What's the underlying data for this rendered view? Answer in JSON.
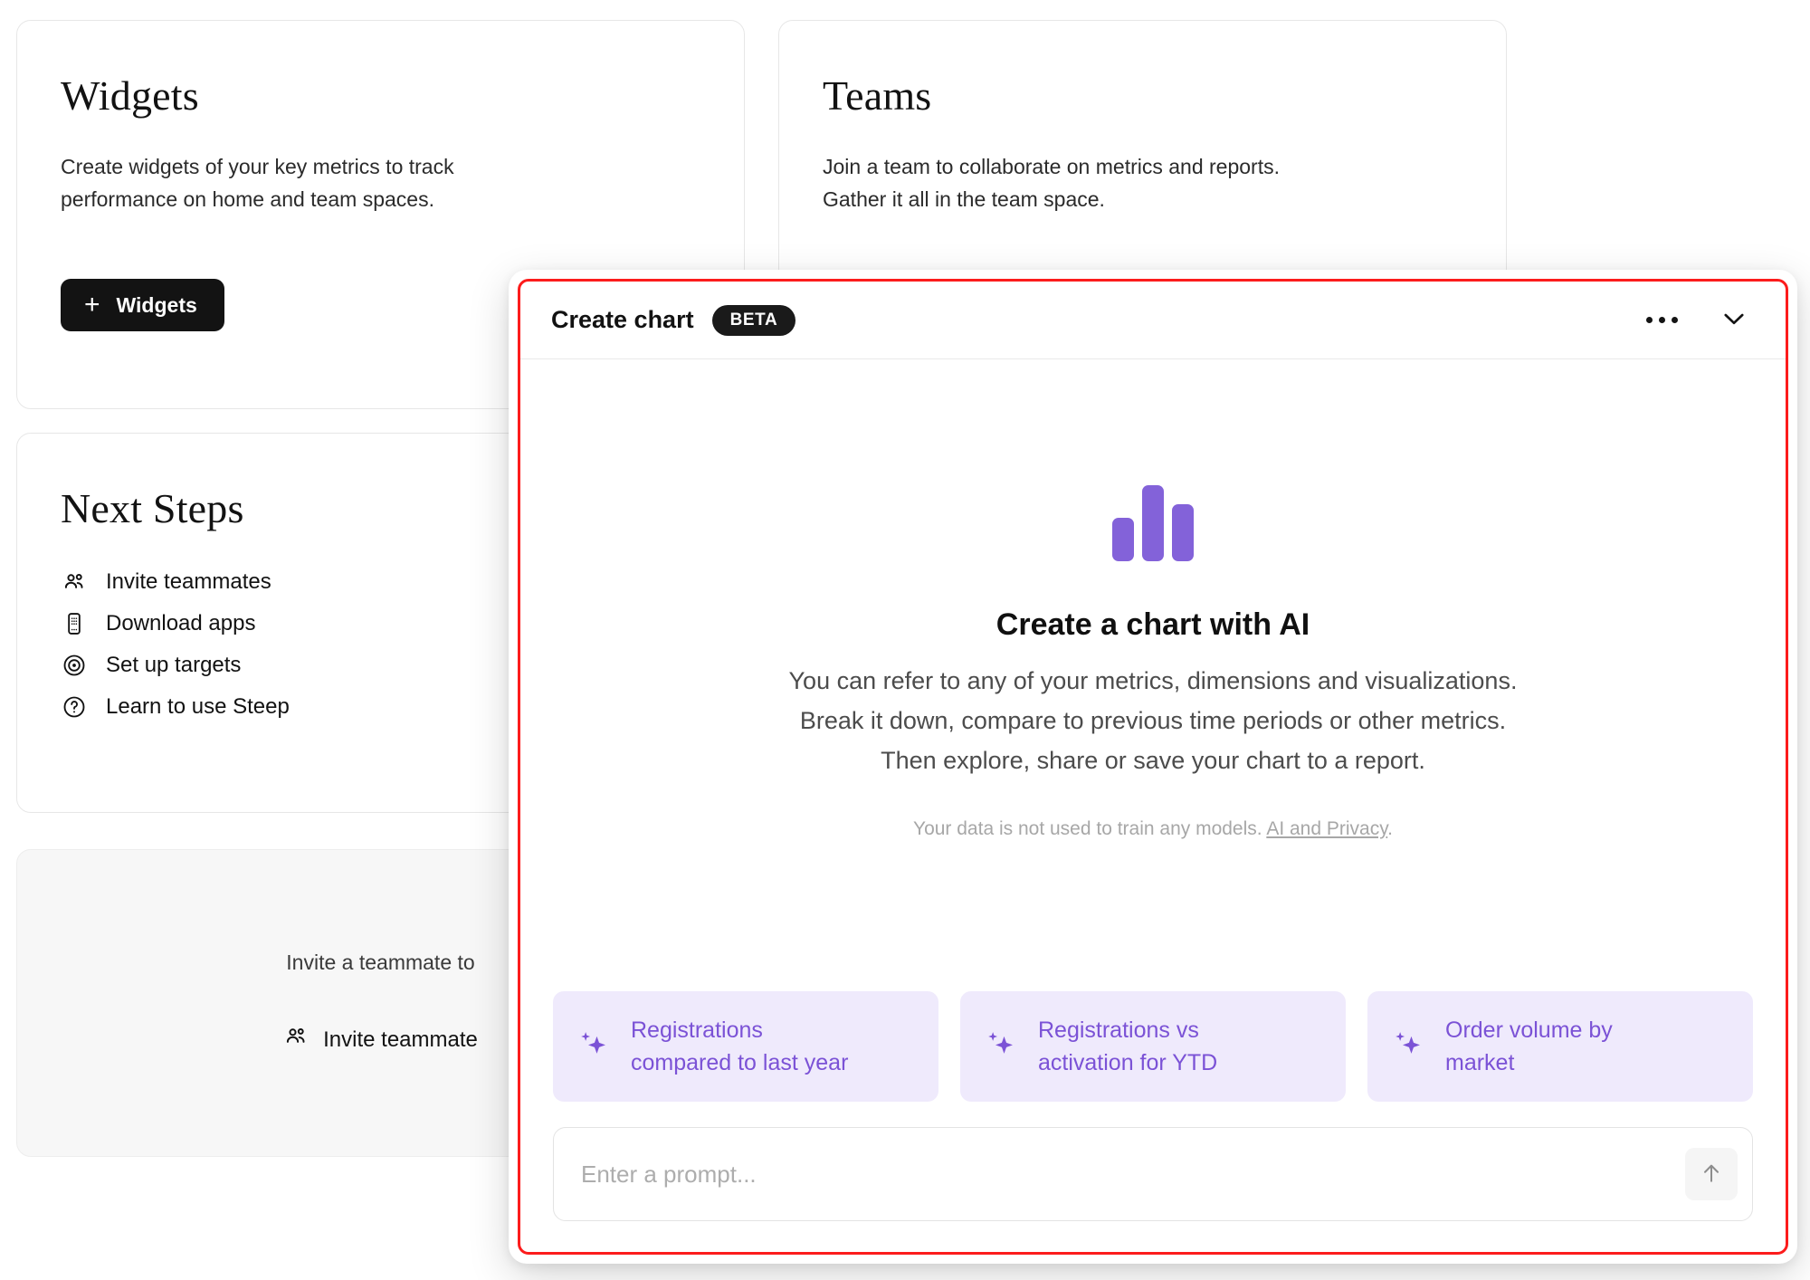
{
  "background": {
    "widgets_card": {
      "title": "Widgets",
      "description_line1": "Create widgets of your key metrics to track",
      "description_line2": "performance on home and team spaces.",
      "button_label": "Widgets",
      "button_plus": "+"
    },
    "teams_card": {
      "title": "Teams",
      "description_line1": "Join a team to collaborate on metrics and reports.",
      "description_line2": "Gather it all in the team space."
    },
    "next_steps_card": {
      "title": "Next Steps",
      "items": [
        {
          "label": "Invite teammates",
          "icon": "users-icon"
        },
        {
          "label": "Download apps",
          "icon": "mobile-device-icon"
        },
        {
          "label": "Set up targets",
          "icon": "target-icon"
        },
        {
          "label": "Learn to use Steep",
          "icon": "question-circle-icon"
        }
      ]
    },
    "invite_card": {
      "caption": "Invite a teammate to",
      "button_label": "Invite teammate"
    }
  },
  "modal": {
    "title": "Create chart",
    "badge": "BETA",
    "more_options_icon": "ellipsis-icon",
    "collapse_icon": "chevron-down-icon",
    "hero": {
      "icon": "bar-chart-icon",
      "title": "Create a chart with AI",
      "line1": "You can refer to any of your metrics, dimensions and visualizations.",
      "line2": "Break it down, compare to previous time periods or other metrics.",
      "line3": "Then explore, share or save your chart to a report.",
      "note_text": "Your data is not used to train any models.",
      "note_link": "AI and Privacy",
      "note_period": "."
    },
    "suggestions": [
      {
        "line1": "Registrations",
        "line2": "compared to last year",
        "icon": "sparkle-icon"
      },
      {
        "line1": "Registrations vs",
        "line2": "activation for YTD",
        "icon": "sparkle-icon"
      },
      {
        "line1": "Order volume by",
        "line2": "market",
        "icon": "sparkle-icon"
      }
    ],
    "prompt": {
      "value": "",
      "placeholder": "Enter a prompt...",
      "send_icon": "arrow-up-icon"
    }
  },
  "colors": {
    "accent_purple": "#7B52D6",
    "chip_background": "#EFEAFC",
    "highlight_red": "#FC1C1C",
    "dark_button": "#131313"
  }
}
